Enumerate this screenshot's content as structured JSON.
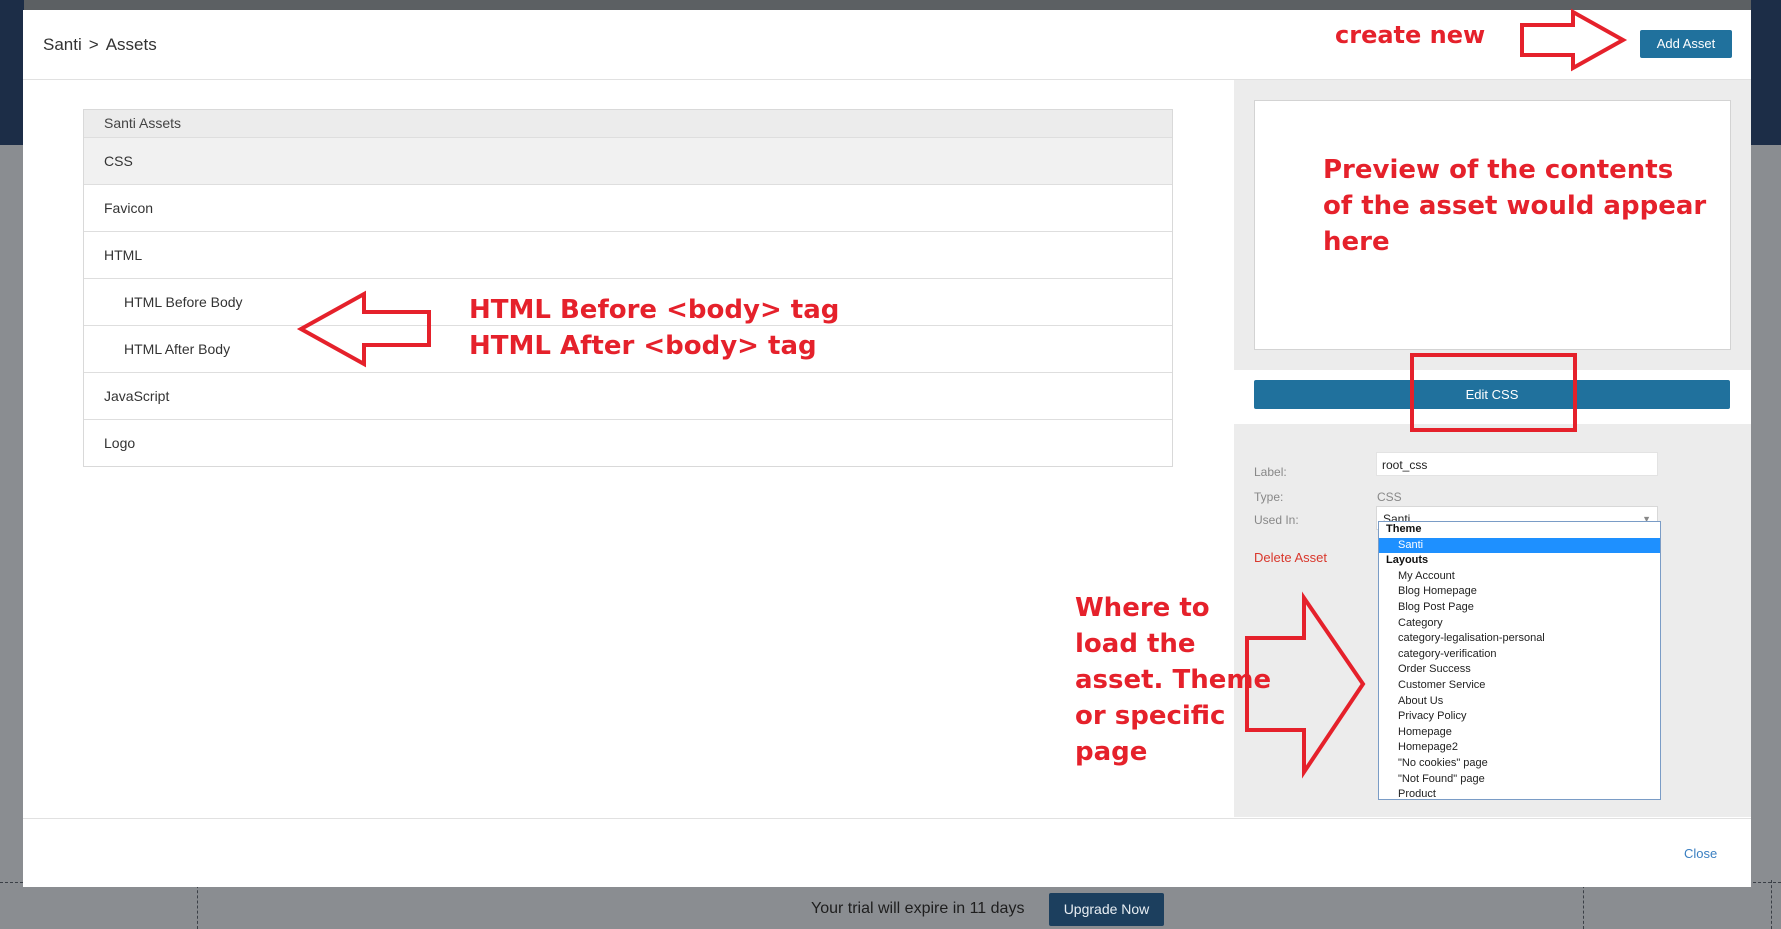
{
  "background": {
    "trial_text": "Your trial will expire in 11 days",
    "upgrade_label": "Upgrade Now"
  },
  "header": {
    "crumb_root": "Santi",
    "crumb_separator": ">",
    "crumb_current": "Assets",
    "add_asset_label": "Add Asset"
  },
  "assets_list": {
    "header": "Santi Assets",
    "rows": [
      {
        "label": "CSS"
      },
      {
        "label": "Favicon"
      },
      {
        "label": "HTML"
      },
      {
        "label": "HTML Before Body"
      },
      {
        "label": "HTML After Body"
      },
      {
        "label": "JavaScript"
      },
      {
        "label": "Logo"
      }
    ]
  },
  "panel": {
    "edit_label": "Edit CSS",
    "label_caption": "Label:",
    "label_value": "root_css",
    "type_caption": "Type:",
    "type_value": "CSS",
    "used_in_caption": "Used In:",
    "used_in_value": "Santi",
    "delete_label": "Delete Asset",
    "options": {
      "theme_group": "Theme",
      "theme_selected": "Santi",
      "layouts_group": "Layouts",
      "layouts": [
        "My Account",
        "Blog Homepage",
        "Blog Post Page",
        "Category",
        "category-legalisation-personal",
        "category-verification",
        "Order Success",
        "Customer Service",
        "About Us",
        "Privacy Policy",
        "Homepage",
        "Homepage2",
        "\"No cookies\" page",
        "\"Not Found\" page",
        "Product"
      ]
    }
  },
  "footer": {
    "close_label": "Close"
  },
  "annotations": {
    "create_new": "create new",
    "preview_line1": "Preview of the contents",
    "preview_line2": "of the asset would appear",
    "preview_line3": "here",
    "html_line1": "HTML Before <body> tag",
    "html_line2": "HTML After <body> tag",
    "where_line1": "Where to",
    "where_line2": "load the",
    "where_line3": "asset. Theme",
    "where_line4": "or specific",
    "where_line5": "page",
    "color": "#e5212b"
  },
  "colors": {
    "primary_button": "#20719d",
    "danger_text": "#d9372c",
    "link": "#3a7fc1",
    "selected_option": "#1e90ff"
  }
}
